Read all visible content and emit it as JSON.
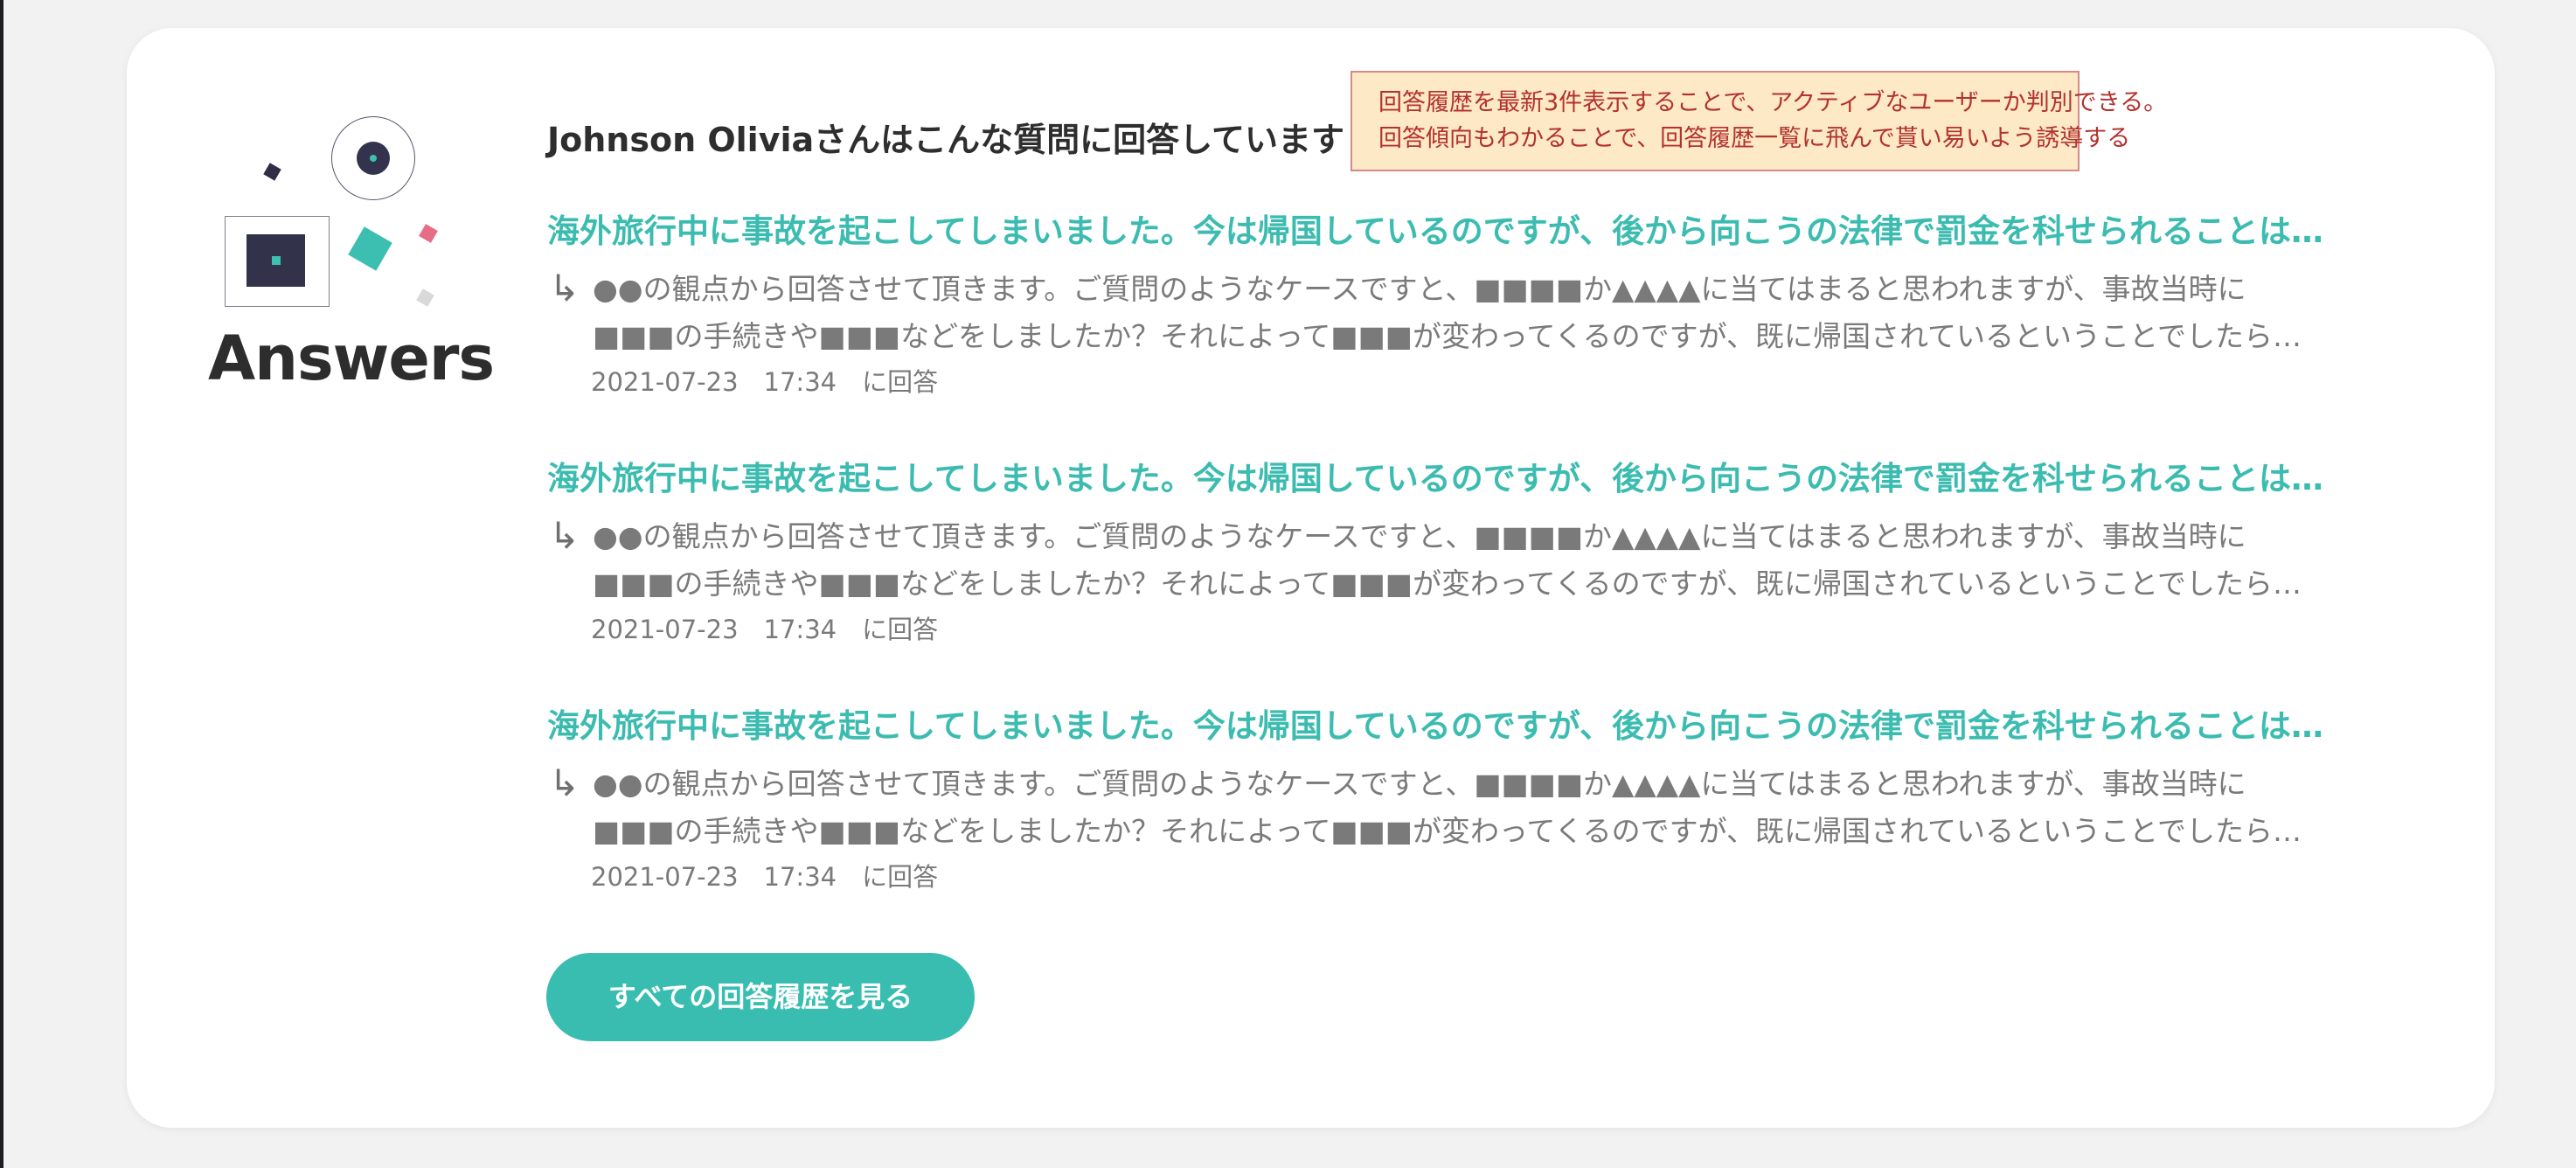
{
  "logo": {
    "title": "Answers"
  },
  "header": {
    "title": "Johnson Oliviaさんはこんな質問に回答しています"
  },
  "annotation": {
    "lines": [
      "回答履歴を最新3件表示することで、アクティブなユーザーか判別できる。",
      "回答傾向もわかることで、回答履歴一覧に飛んで貰い易いよう誘導する"
    ]
  },
  "answers": [
    {
      "question": "海外旅行中に事故を起こしてしまいました。今は帰国しているのですが、後から向こうの法律で罰金を科せられることは…",
      "arrow": "↳",
      "body_line1": "●●の観点から回答させて頂きます。ご質問のようなケースですと、■■■■か▲▲▲▲に当てはまると思われますが、事故当時に",
      "body_line2": "■■■の手続きや■■■などをしましたか？それによって■■■が変わってくるのですが、既に帰国されているということでしたら…",
      "meta": "2021-07-23　17:34　に回答"
    },
    {
      "question": "海外旅行中に事故を起こしてしまいました。今は帰国しているのですが、後から向こうの法律で罰金を科せられることは…",
      "arrow": "↳",
      "body_line1": "●●の観点から回答させて頂きます。ご質問のようなケースですと、■■■■か▲▲▲▲に当てはまると思われますが、事故当時に",
      "body_line2": "■■■の手続きや■■■などをしましたか？それによって■■■が変わってくるのですが、既に帰国されているということでしたら…",
      "meta": "2021-07-23　17:34　に回答"
    },
    {
      "question": "海外旅行中に事故を起こしてしまいました。今は帰国しているのですが、後から向こうの法律で罰金を科せられることは…",
      "arrow": "↳",
      "body_line1": "●●の観点から回答させて頂きます。ご質問のようなケースですと、■■■■か▲▲▲▲に当てはまると思われますが、事故当時に",
      "body_line2": "■■■の手続きや■■■などをしましたか？それによって■■■が変わってくるのですが、既に帰国されているということでしたら…",
      "meta": "2021-07-23　17:34　に回答"
    }
  ],
  "button": {
    "label": "すべての回答履歴を見る"
  },
  "colors": {
    "accent": "#38bdb0",
    "question_text": "#3cbcb0",
    "body_text": "#7a7a7a",
    "heading_text": "#2e2e2e",
    "note_background": "#fde9c6",
    "note_border": "#d48a88",
    "note_text": "#b2322e",
    "logo_dark": "#33324b",
    "logo_pink": "#e56e86"
  }
}
